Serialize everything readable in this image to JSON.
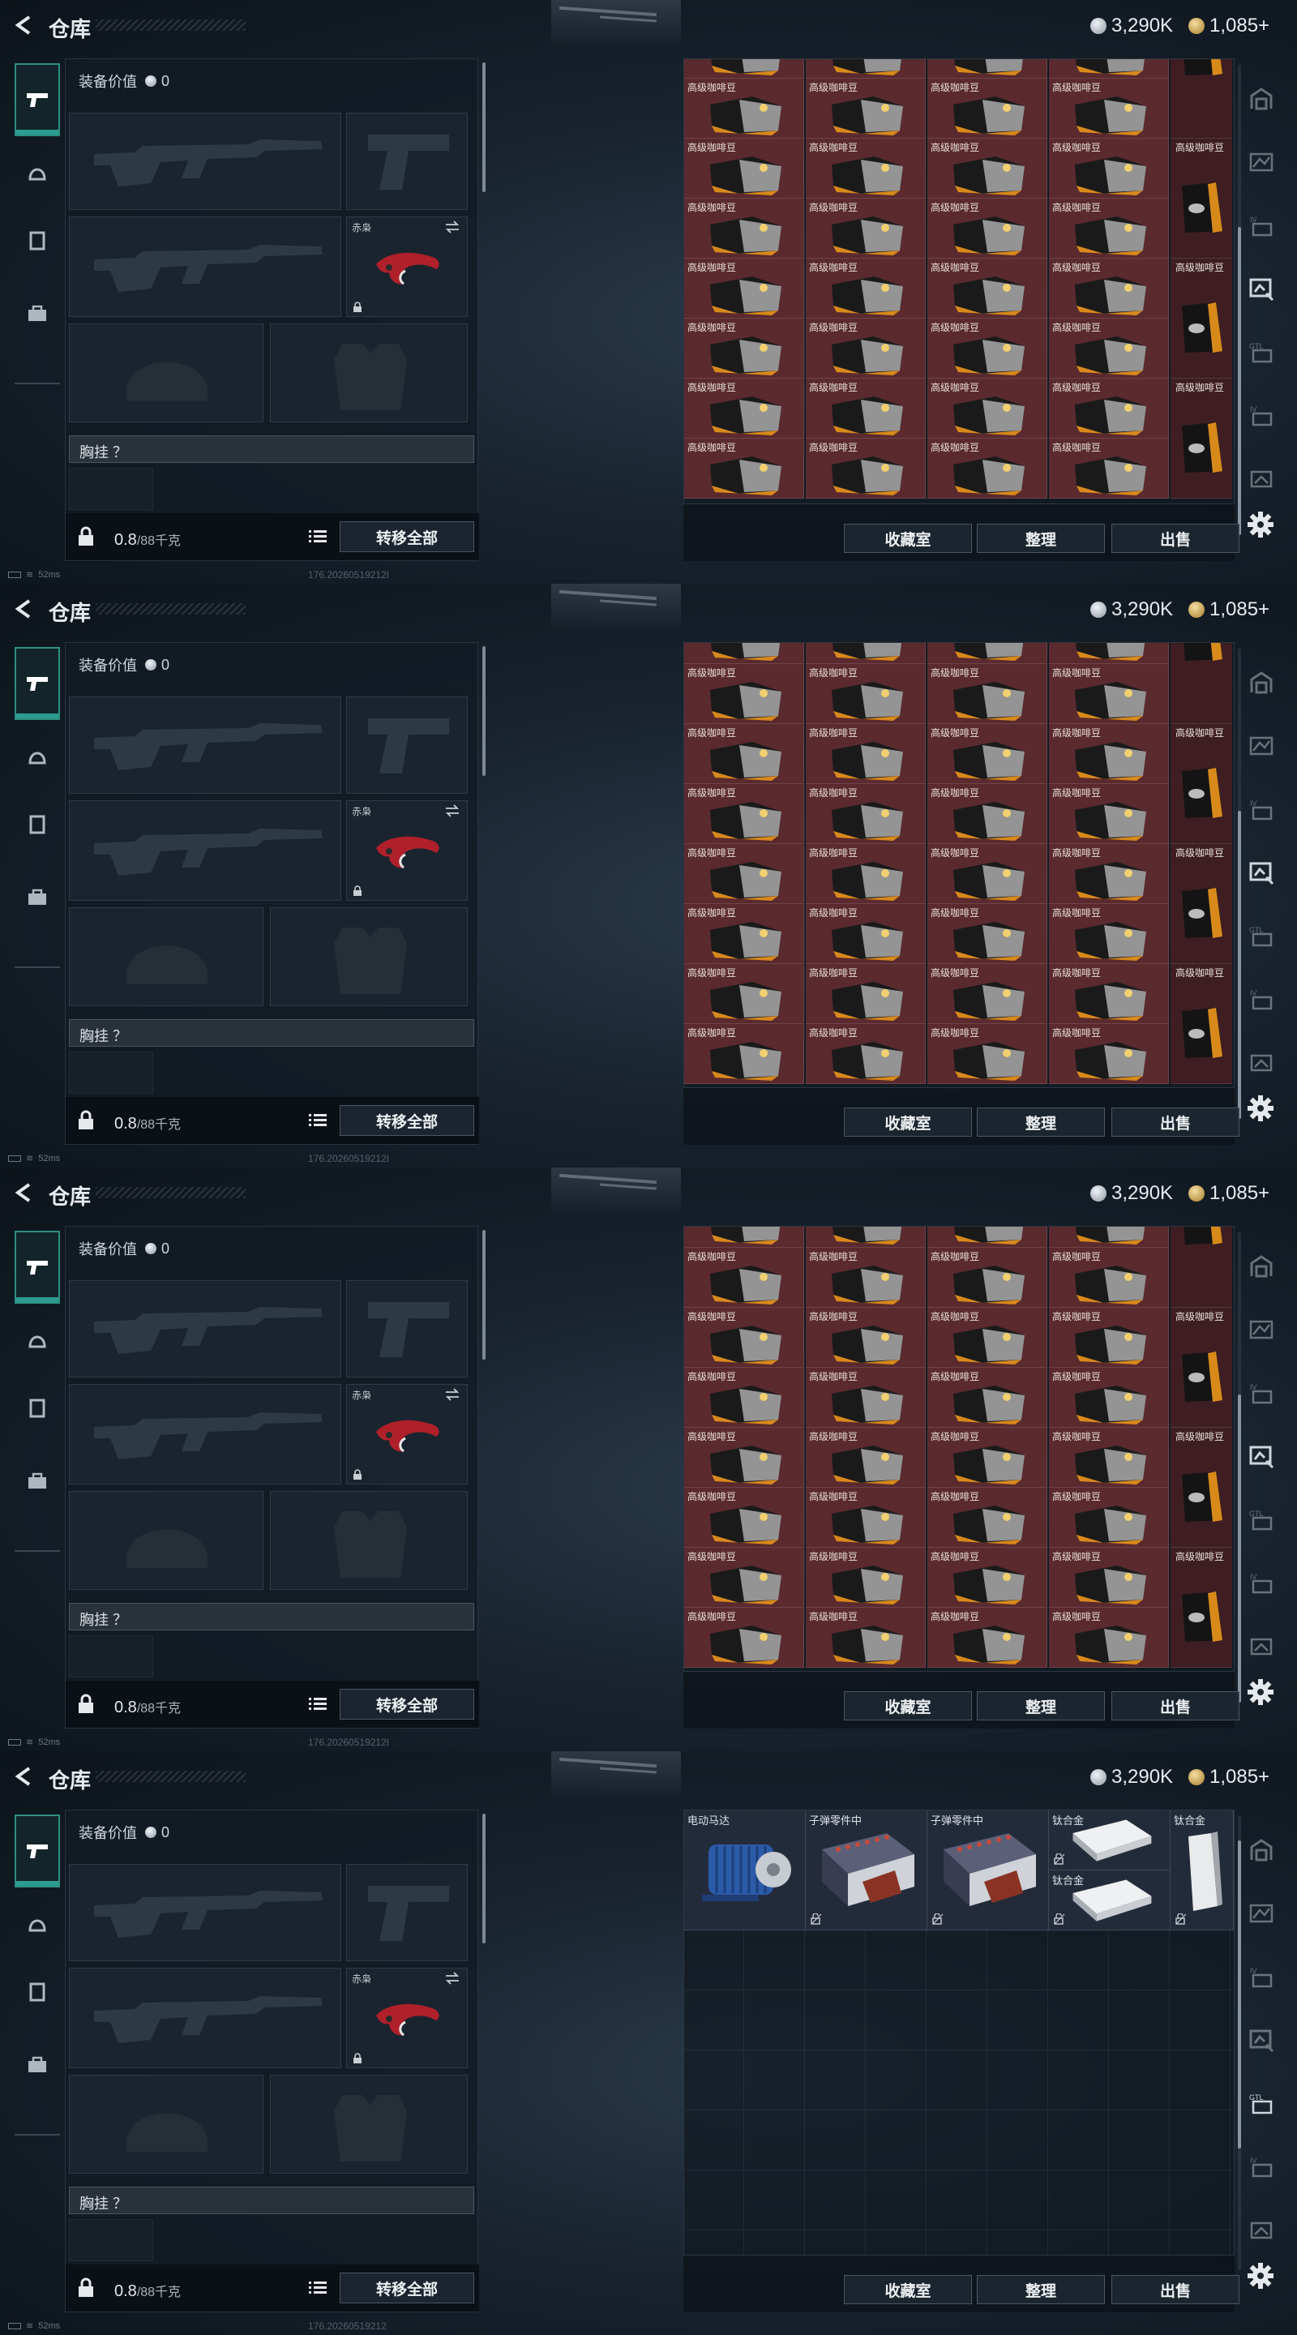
{
  "topbar": {
    "title": "仓库",
    "silver": "3,290K",
    "gold": "1,085+"
  },
  "equipment": {
    "value_label": "装备价值",
    "value": "0",
    "knife_label": "赤枭",
    "chest_label": "胸挂 ？",
    "weight_value": "0.8",
    "weight_max": "/88千克",
    "transfer_all": "转移全部"
  },
  "storage": {
    "coffee_label": "高级咖啡豆",
    "buttons": {
      "collection": "收藏室",
      "sort": "整理",
      "sell": "出售"
    },
    "items_page4": [
      {
        "label": "电动马达"
      },
      {
        "label": "子弹零件中"
      },
      {
        "label": "子弹零件中"
      },
      {
        "label": "钛合金"
      },
      {
        "label": "钛合金"
      },
      {
        "label": "钛合金"
      }
    ]
  },
  "status": {
    "ping": "52ms"
  },
  "frames": [
    {
      "build": "176.20260519212I"
    },
    {
      "build": "176.20260519212I"
    },
    {
      "build": "176.20260519212I"
    },
    {
      "build": "176.20260519212"
    }
  ],
  "colors": {
    "accent": "#2a9d8f",
    "coffee_bg": "#5a2a2e",
    "panel": "#121b24"
  }
}
